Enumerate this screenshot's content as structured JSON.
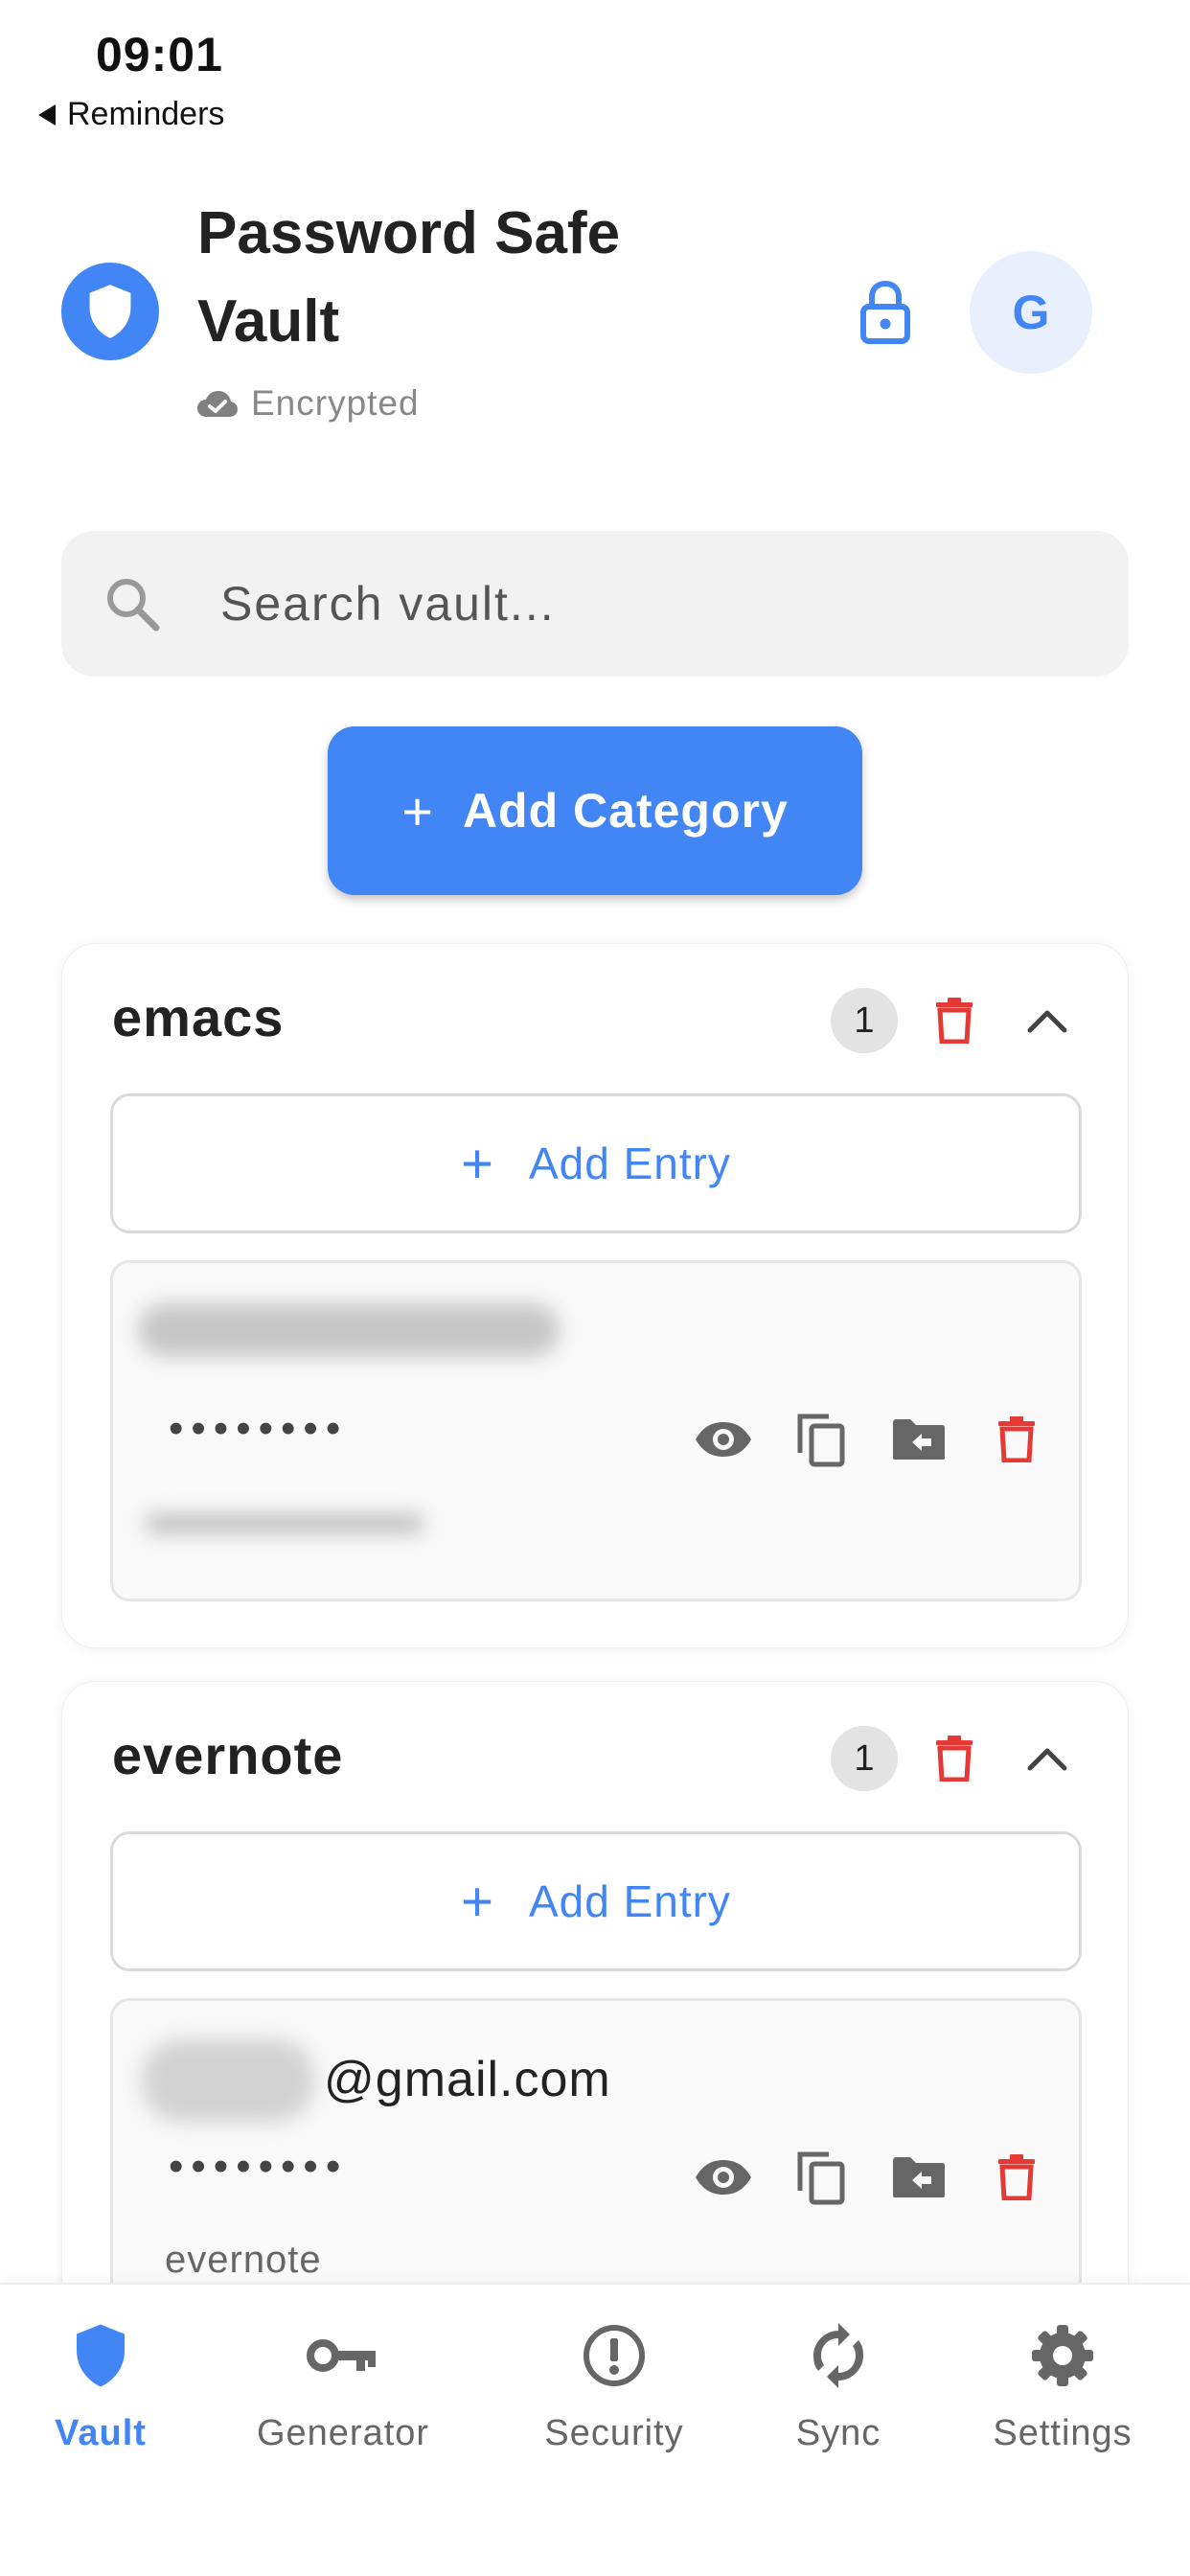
{
  "status_bar": {
    "time": "09:01",
    "back_label": "Reminders"
  },
  "header": {
    "title": "Password Safe Vault",
    "status": "Encrypted",
    "avatar_initial": "G",
    "logo_icon": "shield-icon",
    "lock_icon": "lock-icon"
  },
  "search": {
    "placeholder": "Search vault..."
  },
  "add_category": {
    "label": "Add Category"
  },
  "categories": [
    {
      "name": "emacs",
      "count": "1",
      "add_entry_label": "Add Entry",
      "entries": [
        {
          "username": "",
          "password_mask": "••••••••",
          "site": ""
        }
      ]
    },
    {
      "name": "evernote",
      "count": "1",
      "add_entry_label": "Add Entry",
      "entries": [
        {
          "username": "@gmail.com",
          "password_mask": "••••••••",
          "site": "evernote"
        }
      ]
    }
  ],
  "bottom_nav": {
    "items": [
      {
        "label": "Vault",
        "icon": "shield-icon",
        "active": true
      },
      {
        "label": "Generator",
        "icon": "key-icon",
        "active": false
      },
      {
        "label": "Security",
        "icon": "alert-circle-icon",
        "active": false
      },
      {
        "label": "Sync",
        "icon": "sync-icon",
        "active": false
      },
      {
        "label": "Settings",
        "icon": "gear-icon",
        "active": false
      }
    ]
  },
  "colors": {
    "accent": "#4285F4",
    "danger": "#E53935",
    "icon_gray": "#666666",
    "avatar_bg": "#E8F0FE"
  }
}
